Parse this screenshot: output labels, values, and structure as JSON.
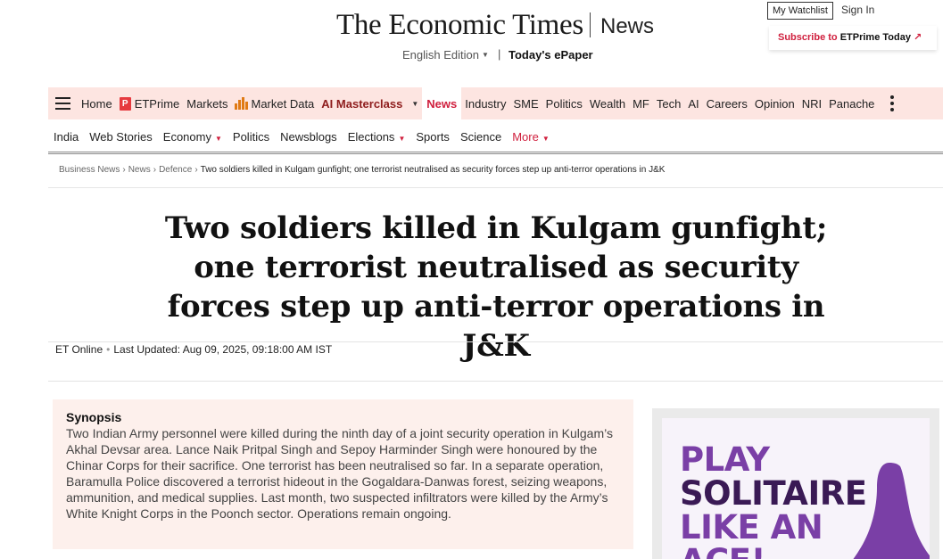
{
  "masthead": {
    "logo": "The Economic Times",
    "section": "News",
    "edition": "English Edition",
    "edition_sep": "|",
    "epaper": "Today's ePaper",
    "watchlist": "My Watchlist",
    "signin": "Sign In",
    "subscribe_prefix": "Subscribe to",
    "subscribe_brand": "ETPrime Today",
    "subscribe_arrow": "↗"
  },
  "nav_primary": {
    "items": [
      "Home",
      "ETPrime",
      "Markets",
      "Market Data",
      "AI Masterclass",
      "News",
      "Industry",
      "SME",
      "Politics",
      "Wealth",
      "MF",
      "Tech",
      "AI",
      "Careers",
      "Opinion",
      "NRI",
      "Panache"
    ],
    "active": "News",
    "icons": {
      "prime": "P",
      "market_data": "bar-chart-icon",
      "more": "kebab-menu-icon"
    }
  },
  "nav_secondary": {
    "items": [
      "India",
      "Web Stories",
      "Economy",
      "Politics",
      "Newsblogs",
      "Elections",
      "Sports",
      "Science",
      "More"
    ]
  },
  "breadcrumb": {
    "items": [
      "Business News",
      "News",
      "Defence"
    ],
    "separator": "›",
    "current": "Two soldiers killed in Kulgam gunfight; one terrorist neutralised as security forces step up anti-terror operations in J&K"
  },
  "article": {
    "headline": "Two soldiers killed in Kulgam gunfight; one terrorist neutralised as security forces step up anti-terror operations in J&K",
    "author": "ET Online",
    "dot": "•",
    "updated": "Last Updated: Aug 09, 2025, 09:18:00 AM IST",
    "synopsis_title": "Synopsis",
    "synopsis_text": "Two Indian Army personnel were killed during the ninth day of a joint security operation in Kulgam’s Akhal Devsar area. Lance Naik Pritpal Singh and Sepoy Harminder Singh were honoured by the Chinar Corps for their sacrifice. One terrorist has been neutralised so far. In a separate operation, Baramulla Police discovered a terrorist hideout in the Gogaldara-Danwas forest, seizing weapons, ammunition, and medical supplies. Last month, two suspected infiltrators were killed by the Army’s White Knight Corps in the Poonch sector. Operations remain ongoing."
  },
  "ad": {
    "lines": [
      "PLAY",
      "SOLITAIRE",
      "LIKE AN",
      "ACE!"
    ]
  },
  "colors": {
    "brand_red": "#d0203e",
    "nav_bg": "#fde5e1",
    "synopsis_bg": "#fdf0ec",
    "ad_purple": "#7a3fa6",
    "ad_dark": "#3a1a55"
  }
}
